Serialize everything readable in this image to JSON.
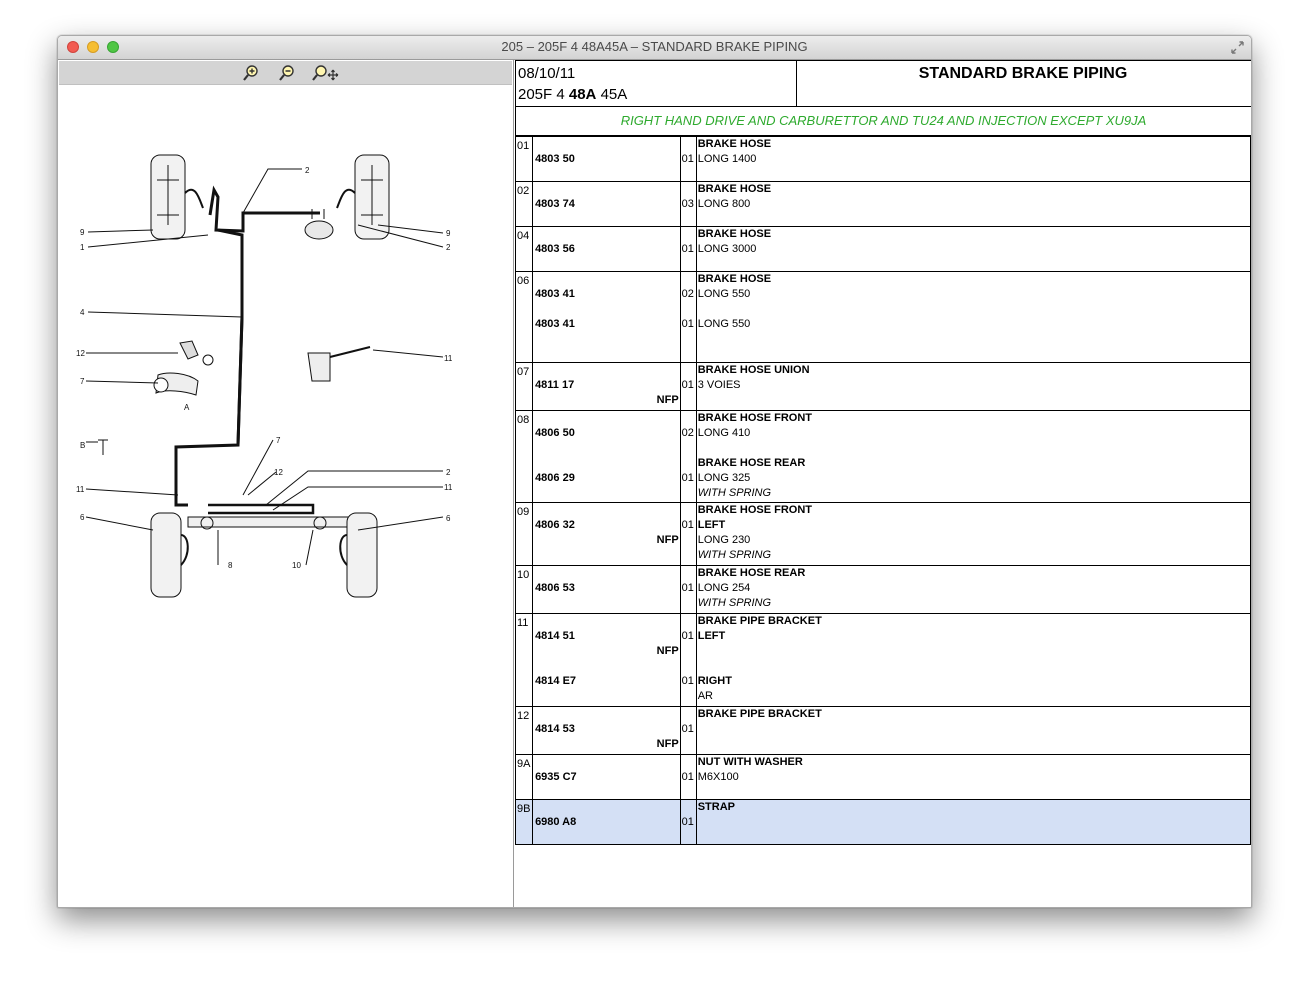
{
  "window": {
    "title": "205 – 205F 4 48A45A – STANDARD BRAKE PIPING"
  },
  "header": {
    "date": "08/10/11",
    "code_a": "205F 4 ",
    "code_b": "48A",
    "code_c": " 45A",
    "title": "STANDARD BRAKE PIPING"
  },
  "condition": "RIGHT HAND DRIVE AND CARBURETTOR AND TU24 AND INJECTION EXCEPT XU9JA",
  "diagram": {
    "callouts": [
      "1",
      "2",
      "4",
      "6",
      "7",
      "8",
      "9",
      "10",
      "11",
      "12",
      "A",
      "B"
    ]
  },
  "rows": [
    {
      "ref": "01",
      "lines": [
        {
          "pn": "",
          "qty": "",
          "desc": "BRAKE HOSE",
          "style": "b"
        },
        {
          "pn": "4803 50",
          "qty": "01",
          "desc": "LONG 1400",
          "style": ""
        }
      ]
    },
    {
      "ref": "02",
      "lines": [
        {
          "pn": "",
          "qty": "",
          "desc": "BRAKE HOSE",
          "style": "b"
        },
        {
          "pn": "4803 74",
          "qty": "03",
          "desc": "LONG 800",
          "style": ""
        }
      ]
    },
    {
      "ref": "04",
      "lines": [
        {
          "pn": "",
          "qty": "",
          "desc": "BRAKE HOSE",
          "style": "b"
        },
        {
          "pn": "4803 56",
          "qty": "01",
          "desc": "LONG 3000",
          "style": ""
        }
      ]
    },
    {
      "ref": "06",
      "lines": [
        {
          "pn": "",
          "qty": "",
          "desc": "BRAKE HOSE",
          "style": "b"
        },
        {
          "pn": "4803 41",
          "qty": "02",
          "desc": "LONG 550",
          "style": ""
        },
        {
          "pn": "",
          "qty": "",
          "desc": "",
          "style": ""
        },
        {
          "pn": "4803 41",
          "qty": "01",
          "desc": "LONG 550",
          "style": ""
        },
        {
          "pn": "",
          "qty": "",
          "desc": "",
          "style": ""
        },
        {
          "pn": "",
          "qty": "",
          "desc": "",
          "style": ""
        }
      ]
    },
    {
      "ref": "07",
      "lines": [
        {
          "pn": "",
          "qty": "",
          "desc": "BRAKE HOSE UNION",
          "style": "b"
        },
        {
          "pn": "4811 17",
          "qty": "01",
          "desc": "3 VOIES",
          "style": ""
        },
        {
          "pn": "",
          "nfp": "NFP",
          "qty": "",
          "desc": "",
          "style": ""
        }
      ]
    },
    {
      "ref": "08",
      "lines": [
        {
          "pn": "",
          "qty": "",
          "desc": "BRAKE HOSE FRONT",
          "style": "b"
        },
        {
          "pn": "4806 50",
          "qty": "02",
          "desc": "LONG 410",
          "style": ""
        },
        {
          "pn": "",
          "qty": "",
          "desc": "",
          "style": ""
        },
        {
          "pn": "",
          "qty": "",
          "desc": "BRAKE HOSE REAR",
          "style": "b"
        },
        {
          "pn": "4806 29",
          "qty": "01",
          "desc": "LONG 325",
          "style": ""
        },
        {
          "pn": "",
          "qty": "",
          "desc": "WITH SPRING",
          "style": "i"
        }
      ]
    },
    {
      "ref": "09",
      "lines": [
        {
          "pn": "",
          "qty": "",
          "desc": "BRAKE HOSE FRONT",
          "style": "b"
        },
        {
          "pn": "4806 32",
          "qty": "01",
          "desc": "LEFT",
          "style": "b"
        },
        {
          "pn": "",
          "nfp": "NFP",
          "qty": "",
          "desc": "LONG 230",
          "style": ""
        },
        {
          "pn": "",
          "qty": "",
          "desc": "WITH SPRING",
          "style": "i"
        }
      ]
    },
    {
      "ref": "10",
      "lines": [
        {
          "pn": "",
          "qty": "",
          "desc": "BRAKE HOSE REAR",
          "style": "b"
        },
        {
          "pn": "4806 53",
          "qty": "01",
          "desc": "LONG 254",
          "style": ""
        },
        {
          "pn": "",
          "qty": "",
          "desc": "WITH SPRING",
          "style": "i"
        }
      ]
    },
    {
      "ref": "11",
      "lines": [
        {
          "pn": "",
          "qty": "",
          "desc": "BRAKE PIPE BRACKET",
          "style": "b"
        },
        {
          "pn": "4814 51",
          "qty": "01",
          "desc": "LEFT",
          "style": "b"
        },
        {
          "pn": "",
          "nfp": "NFP",
          "qty": "",
          "desc": "",
          "style": ""
        },
        {
          "pn": "",
          "qty": "",
          "desc": "",
          "style": ""
        },
        {
          "pn": "4814 E7",
          "qty": "01",
          "desc": "RIGHT",
          "style": "b"
        },
        {
          "pn": "",
          "qty": "",
          "desc": "AR",
          "style": ""
        }
      ]
    },
    {
      "ref": "12",
      "lines": [
        {
          "pn": "",
          "qty": "",
          "desc": "BRAKE PIPE BRACKET",
          "style": "b"
        },
        {
          "pn": "4814 53",
          "qty": "01",
          "desc": "",
          "style": ""
        },
        {
          "pn": "",
          "nfp": "NFP",
          "qty": "",
          "desc": "",
          "style": ""
        }
      ]
    },
    {
      "ref": "9A",
      "lines": [
        {
          "pn": "",
          "qty": "",
          "desc": "NUT WITH WASHER",
          "style": "b"
        },
        {
          "pn": "6935 C7",
          "qty": "01",
          "desc": "M6X100",
          "style": ""
        }
      ]
    },
    {
      "ref": "9B",
      "selected": true,
      "lines": [
        {
          "pn": "",
          "qty": "",
          "desc": "STRAP",
          "style": "b"
        },
        {
          "pn": "6980 A8",
          "qty": "01",
          "desc": "",
          "style": ""
        }
      ]
    }
  ]
}
